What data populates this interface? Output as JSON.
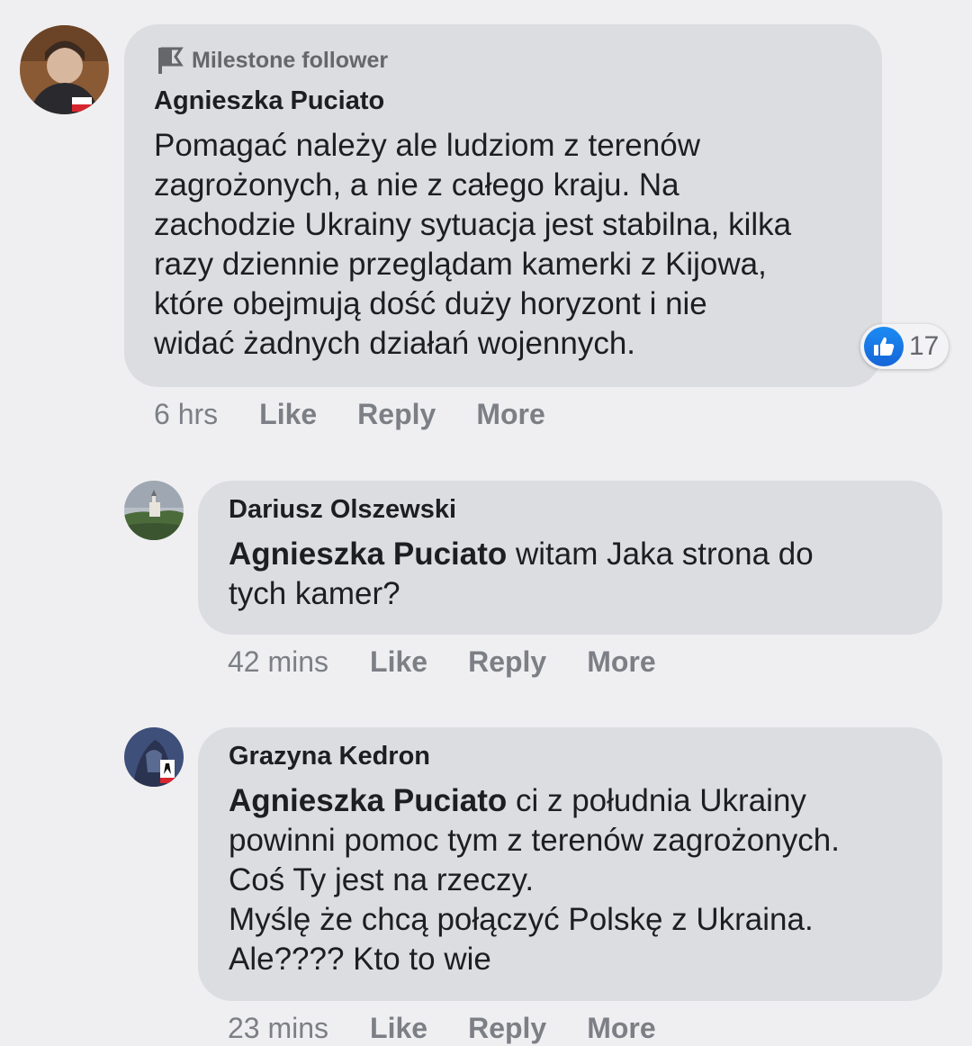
{
  "comments": [
    {
      "badge": "Milestone follower",
      "author": "Agnieszka Puciato",
      "text": "Pomagać należy ale ludziom z terenów\nzagrożonych, a nie z całego kraju. Na\nzachodzie Ukrainy sytuacja jest stabilna, kilka\nrazy dziennie przeglądam kamerki z Kijowa,\nktóre obejmują dość duży horyzont i nie\nwidać żadnych działań wojennych.",
      "reaction_count": "17",
      "time": "6 hrs",
      "like": "Like",
      "reply": "Reply",
      "more": "More"
    },
    {
      "author": "Dariusz Olszewski",
      "mention": "Agnieszka Puciato",
      "text": " witam Jaka strona do\ntych kamer?",
      "time": "42 mins",
      "like": "Like",
      "reply": "Reply",
      "more": "More"
    },
    {
      "author": "Grazyna Kedron",
      "mention": "Agnieszka Puciato",
      "text": " ci z południa Ukrainy\npowinni pomoc tym z terenów zagrożonych.\nCoś Ty jest na rzeczy.\nMyślę że chcą połączyć Polskę z Ukraina.\nAle???? Kto to wie",
      "time": "23 mins",
      "like": "Like",
      "reply": "Reply",
      "more": "More"
    }
  ],
  "icons": {
    "badge": "flag-icon",
    "reaction": "thumbs-up-icon"
  },
  "colors": {
    "background": "#efeff1",
    "bubble": "#dcdde1",
    "like_blue": "#1877f2",
    "secondary_text": "#7c7f85"
  }
}
